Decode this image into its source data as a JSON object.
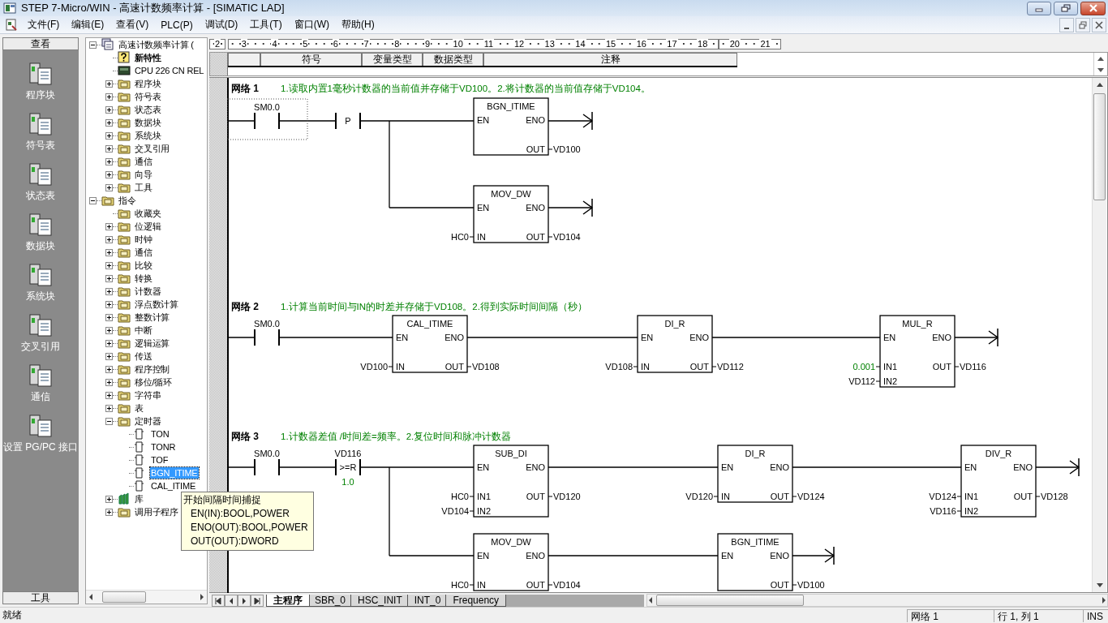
{
  "window": {
    "title": "STEP 7-Micro/WIN - 高速计数频率计算 - [SIMATIC LAD]"
  },
  "menu": [
    "文件(F)",
    "编辑(E)",
    "查看(V)",
    "PLC(P)",
    "调试(D)",
    "工具(T)",
    "窗口(W)",
    "帮助(H)"
  ],
  "nav_bar": {
    "header": "查看",
    "items": [
      {
        "label": "程序块"
      },
      {
        "label": "符号表"
      },
      {
        "label": "状态表"
      },
      {
        "label": "数据块"
      },
      {
        "label": "系统块"
      },
      {
        "label": "交叉引用"
      },
      {
        "label": "通信"
      },
      {
        "label": "设置 PG/PC 接口"
      }
    ],
    "footer": "工具"
  },
  "tree": [
    {
      "label": "高速计数频率计算 (",
      "kind": "project",
      "expanded": true,
      "selected": false,
      "children": [
        {
          "label": "新特性",
          "kind": "help",
          "selected": false
        },
        {
          "label": "CPU 226 CN REL",
          "kind": "device",
          "selected": false
        },
        {
          "label": "程序块",
          "kind": "folder",
          "expanded": false,
          "selected": false
        },
        {
          "label": "符号表",
          "kind": "folder",
          "expanded": false,
          "selected": false
        },
        {
          "label": "状态表",
          "kind": "folder",
          "expanded": false,
          "selected": false
        },
        {
          "label": "数据块",
          "kind": "folder",
          "expanded": false,
          "selected": false
        },
        {
          "label": "系统块",
          "kind": "folder",
          "expanded": false,
          "selected": false
        },
        {
          "label": "交叉引用",
          "kind": "folder",
          "expanded": false,
          "selected": false
        },
        {
          "label": "通信",
          "kind": "folder",
          "expanded": false,
          "selected": false
        },
        {
          "label": "向导",
          "kind": "folder",
          "expanded": false,
          "selected": false
        },
        {
          "label": "工具",
          "kind": "folder",
          "expanded": false,
          "selected": false
        }
      ]
    },
    {
      "label": "指令",
      "kind": "folder",
      "expanded": true,
      "selected": false,
      "children": [
        {
          "label": "收藏夹",
          "kind": "folder",
          "selected": false
        },
        {
          "label": "位逻辑",
          "kind": "folder",
          "expanded": false,
          "selected": false
        },
        {
          "label": "时钟",
          "kind": "folder",
          "expanded": false,
          "selected": false
        },
        {
          "label": "通信",
          "kind": "folder",
          "expanded": false,
          "selected": false
        },
        {
          "label": "比较",
          "kind": "folder",
          "expanded": false,
          "selected": false
        },
        {
          "label": "转换",
          "kind": "folder",
          "expanded": false,
          "selected": false
        },
        {
          "label": "计数器",
          "kind": "folder",
          "expanded": false,
          "selected": false
        },
        {
          "label": "浮点数计算",
          "kind": "folder",
          "expanded": false,
          "selected": false
        },
        {
          "label": "整数计算",
          "kind": "folder",
          "expanded": false,
          "selected": false
        },
        {
          "label": "中断",
          "kind": "folder",
          "expanded": false,
          "selected": false
        },
        {
          "label": "逻辑运算",
          "kind": "folder",
          "expanded": false,
          "selected": false
        },
        {
          "label": "传送",
          "kind": "folder",
          "expanded": false,
          "selected": false
        },
        {
          "label": "程序控制",
          "kind": "folder",
          "expanded": false,
          "selected": false
        },
        {
          "label": "移位/循环",
          "kind": "folder",
          "expanded": false,
          "selected": false
        },
        {
          "label": "字符串",
          "kind": "folder",
          "expanded": false,
          "selected": false
        },
        {
          "label": "表",
          "kind": "folder",
          "expanded": false,
          "selected": false
        },
        {
          "label": "定时器",
          "kind": "folder",
          "expanded": true,
          "selected": false,
          "children": [
            {
              "label": "TON",
              "kind": "instruction",
              "selected": false
            },
            {
              "label": "TONR",
              "kind": "instruction",
              "selected": false
            },
            {
              "label": "TOF",
              "kind": "instruction",
              "selected": false
            },
            {
              "label": "BGN_ITIME",
              "kind": "instruction",
              "selected": true
            },
            {
              "label": "CAL_ITIME",
              "kind": "instruction",
              "selected": false
            }
          ]
        },
        {
          "label": "库",
          "kind": "library",
          "expanded": false,
          "selected": false
        },
        {
          "label": "调用子程序",
          "kind": "folder",
          "expanded": false,
          "selected": false
        }
      ]
    }
  ],
  "ruler": {
    "segments": [
      [
        "2"
      ],
      [
        "3",
        "4",
        "5",
        "6",
        "7",
        "8",
        "9",
        "10",
        "11",
        "12",
        "13",
        "14",
        "15",
        "16",
        "17",
        "18"
      ],
      [
        "20",
        "21"
      ]
    ]
  },
  "variable_table": {
    "columns": [
      "符号",
      "变量类型",
      "数据类型",
      "注释"
    ]
  },
  "networks": [
    {
      "title": "网络 1",
      "comment": "1.读取内置1毫秒计数器的当前值并存储于VD100。2.将计数器的当前值存储于VD104。",
      "elements": [
        {
          "kind": "contact",
          "operand": "SM0.0",
          "selected": true
        },
        {
          "kind": "edge",
          "label": "P",
          "selected": false
        },
        {
          "kind": "box",
          "name": "BGN_ITIME",
          "selected": false,
          "inputs": [
            {
              "pin": "EN"
            }
          ],
          "outputs": [
            {
              "pin": "ENO"
            },
            {
              "pin": "OUT",
              "operand": "VD100",
              "constant": false
            }
          ]
        },
        {
          "kind": "box",
          "name": "MOV_DW",
          "selected": false,
          "inputs": [
            {
              "pin": "EN"
            },
            {
              "pin": "IN",
              "operand": "HC0",
              "constant": false
            }
          ],
          "outputs": [
            {
              "pin": "ENO"
            },
            {
              "pin": "OUT",
              "operand": "VD104",
              "constant": false
            }
          ]
        }
      ]
    },
    {
      "title": "网络 2",
      "comment": "1.计算当前时间与IN的时差并存储于VD108。2.得到实际时间间隔（秒）",
      "elements": [
        {
          "kind": "contact",
          "operand": "SM0.0",
          "selected": false
        },
        {
          "kind": "box",
          "name": "CAL_ITIME",
          "selected": false,
          "inputs": [
            {
              "pin": "EN"
            },
            {
              "pin": "IN",
              "operand": "VD100",
              "constant": false
            }
          ],
          "outputs": [
            {
              "pin": "ENO"
            },
            {
              "pin": "OUT",
              "operand": "VD108",
              "constant": false
            }
          ]
        },
        {
          "kind": "box",
          "name": "DI_R",
          "selected": false,
          "inputs": [
            {
              "pin": "EN"
            },
            {
              "pin": "IN",
              "operand": "VD108",
              "constant": false
            }
          ],
          "outputs": [
            {
              "pin": "ENO"
            },
            {
              "pin": "OUT",
              "operand": "VD112",
              "constant": false
            }
          ]
        },
        {
          "kind": "box",
          "name": "MUL_R",
          "selected": false,
          "inputs": [
            {
              "pin": "EN"
            },
            {
              "pin": "IN1",
              "operand": "0.001",
              "constant": true
            },
            {
              "pin": "IN2",
              "operand": "VD112",
              "constant": false
            }
          ],
          "outputs": [
            {
              "pin": "ENO"
            },
            {
              "pin": "OUT",
              "operand": "VD116",
              "constant": false
            }
          ]
        }
      ]
    },
    {
      "title": "网络 3",
      "comment": "1.计数器差值 /时间差=频率。2.复位时间和脉冲计数器",
      "elements": [
        {
          "kind": "contact",
          "operand": "SM0.0",
          "selected": false
        },
        {
          "kind": "compare",
          "operand": "VD116",
          "op": ">=R",
          "reference": {
            "value": "1.0",
            "constant": true
          },
          "selected": false
        },
        {
          "kind": "box",
          "name": "SUB_DI",
          "selected": false,
          "inputs": [
            {
              "pin": "EN"
            },
            {
              "pin": "IN1",
              "operand": "HC0",
              "constant": false
            },
            {
              "pin": "IN2",
              "operand": "VD104",
              "constant": false
            }
          ],
          "outputs": [
            {
              "pin": "ENO"
            },
            {
              "pin": "OUT",
              "operand": "VD120",
              "constant": false
            }
          ]
        },
        {
          "kind": "box",
          "name": "DI_R",
          "selected": false,
          "inputs": [
            {
              "pin": "EN"
            },
            {
              "pin": "IN",
              "operand": "VD120",
              "constant": false
            }
          ],
          "outputs": [
            {
              "pin": "ENO"
            },
            {
              "pin": "OUT",
              "operand": "VD124",
              "constant": false
            }
          ]
        },
        {
          "kind": "box",
          "name": "DIV_R",
          "selected": false,
          "inputs": [
            {
              "pin": "EN"
            },
            {
              "pin": "IN1",
              "operand": "VD124",
              "constant": false
            },
            {
              "pin": "IN2",
              "operand": "VD116",
              "constant": false
            }
          ],
          "outputs": [
            {
              "pin": "ENO"
            },
            {
              "pin": "OUT",
              "operand": "VD128",
              "constant": false
            }
          ]
        },
        {
          "kind": "box",
          "name": "MOV_DW",
          "selected": false,
          "inputs": [
            {
              "pin": "EN"
            },
            {
              "pin": "IN",
              "operand": "HC0",
              "constant": false
            }
          ],
          "outputs": [
            {
              "pin": "ENO"
            },
            {
              "pin": "OUT",
              "operand": "VD104",
              "constant": false
            }
          ]
        },
        {
          "kind": "box",
          "name": "BGN_ITIME",
          "selected": false,
          "inputs": [
            {
              "pin": "EN"
            }
          ],
          "outputs": [
            {
              "pin": "ENO"
            },
            {
              "pin": "OUT",
              "operand": "VD100",
              "constant": false
            }
          ]
        }
      ]
    }
  ],
  "tooltip": {
    "title": "开始间隔时间捕捉",
    "lines": [
      "EN(IN):BOOL,POWER",
      "ENO(OUT):BOOL,POWER",
      "OUT(OUT):DWORD"
    ]
  },
  "tabs": [
    {
      "label": "主程序",
      "selected": true
    },
    {
      "label": "SBR_0",
      "selected": false
    },
    {
      "label": "HSC_INIT",
      "selected": false
    },
    {
      "label": "INT_0",
      "selected": false
    },
    {
      "label": "Frequency",
      "selected": false
    }
  ],
  "status_bar": {
    "message": "就绪",
    "network": "网络 1",
    "position": "行 1, 列 1",
    "mode": "INS"
  }
}
